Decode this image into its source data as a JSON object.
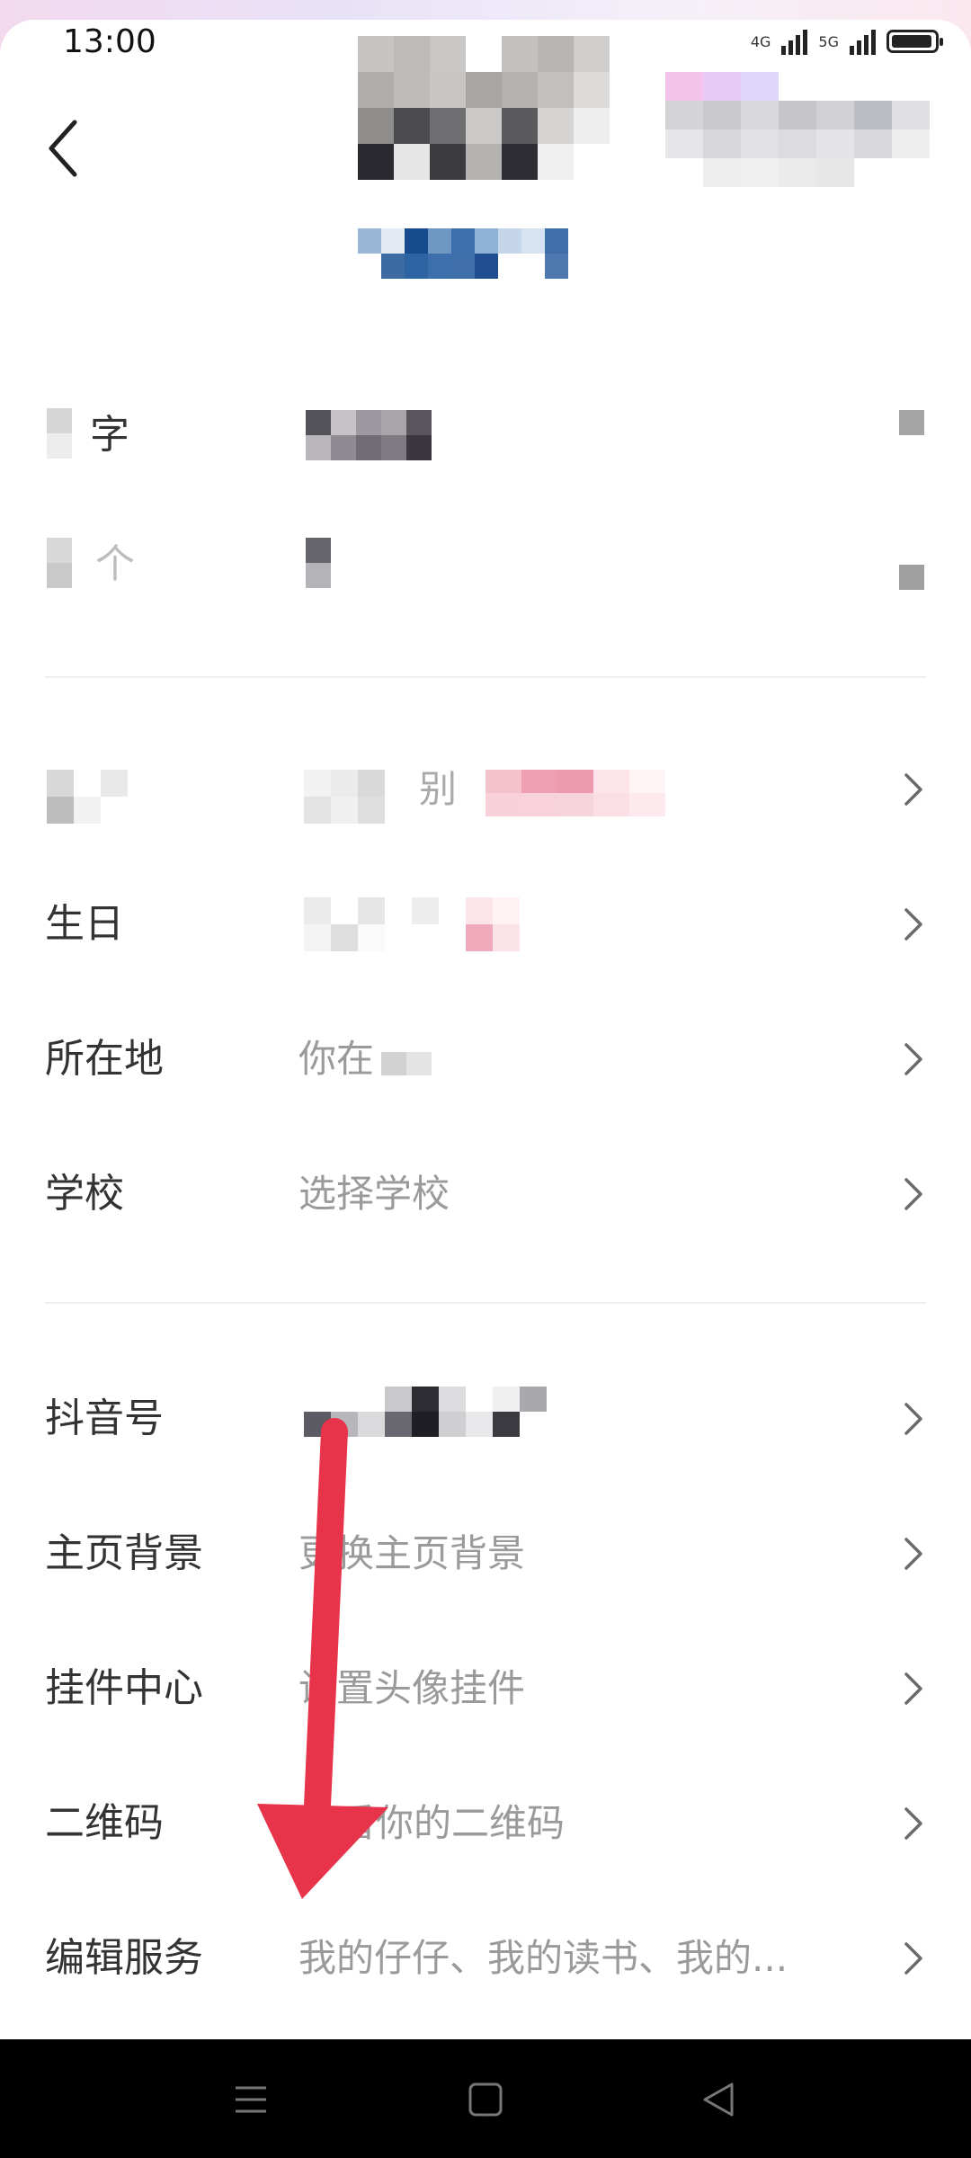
{
  "status_bar": {
    "time": "13:00",
    "network_labels": [
      "4G",
      "5G"
    ]
  },
  "header": {
    "back_icon": "chevron-left-icon"
  },
  "profile_section": {
    "rows": [
      {
        "label": "字",
        "value": ""
      },
      {
        "label": "个",
        "value": ""
      }
    ]
  },
  "info_section": {
    "rows": [
      {
        "label": "",
        "value": "别"
      },
      {
        "label": "生日",
        "value": ""
      },
      {
        "label": "所在地",
        "value": "你在"
      },
      {
        "label": "学校",
        "value": "选择学校"
      }
    ]
  },
  "service_section": {
    "rows": [
      {
        "label": "抖音号",
        "value": ""
      },
      {
        "label": "主页背景",
        "value": "更换主页背景"
      },
      {
        "label": "挂件中心",
        "value": "设置头像挂件"
      },
      {
        "label": "二维码",
        "value": "看你的二维码"
      },
      {
        "label": "编辑服务",
        "value": "我的仔仔、我的读书、我的..."
      }
    ]
  },
  "colors": {
    "annotation_arrow": "#e8344a",
    "label_text": "#333333",
    "value_text": "#9a9a9a"
  },
  "nav_bar": {
    "icons": [
      "menu-icon",
      "home-icon",
      "back-triangle-icon"
    ]
  }
}
